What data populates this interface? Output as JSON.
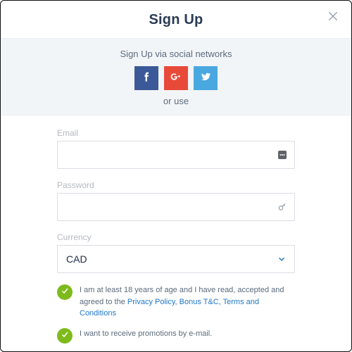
{
  "header": {
    "title": "Sign Up"
  },
  "social": {
    "caption": "Sign Up via social networks",
    "or": "or use"
  },
  "form": {
    "email_label": "Email",
    "email_value": "",
    "password_label": "Password",
    "password_value": "",
    "currency_label": "Currency",
    "currency_value": "CAD"
  },
  "consents": {
    "age_text_pre": "I am at least 18 years of age and I have read, accepted and agreed to the ",
    "privacy_link": "Privacy Policy",
    "sep1": ", ",
    "bonus_link": "Bonus T&C",
    "sep2": ", ",
    "terms_link": "Terms and Conditions",
    "promo_text": "I want to receive promotions by e-mail."
  }
}
